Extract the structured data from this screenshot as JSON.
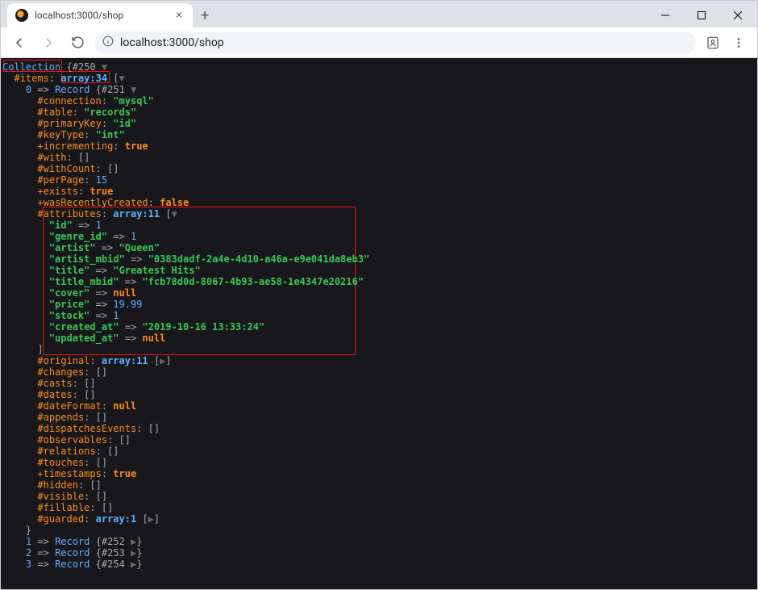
{
  "browser": {
    "tab_title": "localhost:3000/shop",
    "url": "localhost:3000/shop"
  },
  "dump": {
    "class": "Collection",
    "object_id": "#250",
    "items": {
      "key": "#items",
      "type": "array:34",
      "first_index": "0",
      "record_class": "Record",
      "record_id": "#251"
    },
    "record_props": [
      {
        "sym": "#",
        "key": "connection",
        "val": "\"mysql\"",
        "cls": "str"
      },
      {
        "sym": "#",
        "key": "table",
        "val": "\"records\"",
        "cls": "str"
      },
      {
        "sym": "#",
        "key": "primaryKey",
        "val": "\"id\"",
        "cls": "str"
      },
      {
        "sym": "#",
        "key": "keyType",
        "val": "\"int\"",
        "cls": "str"
      },
      {
        "sym": "+",
        "key": "incrementing",
        "val": "true",
        "cls": "bool"
      },
      {
        "sym": "#",
        "key": "with",
        "val": "[]",
        "cls": "punc"
      },
      {
        "sym": "#",
        "key": "withCount",
        "val": "[]",
        "cls": "punc"
      },
      {
        "sym": "#",
        "key": "perPage",
        "val": "15",
        "cls": "num"
      },
      {
        "sym": "+",
        "key": "exists",
        "val": "true",
        "cls": "bool"
      },
      {
        "sym": "+",
        "key": "wasRecentlyCreated",
        "val": "false",
        "cls": "bool"
      }
    ],
    "attributes_header": {
      "key": "#attributes",
      "type": "array:11"
    },
    "attributes": [
      {
        "k": "\"id\"",
        "v": "1",
        "cls": "num"
      },
      {
        "k": "\"genre_id\"",
        "v": "1",
        "cls": "num"
      },
      {
        "k": "\"artist\"",
        "v": "\"Queen\"",
        "cls": "str"
      },
      {
        "k": "\"artist_mbid\"",
        "v": "\"0383dadf-2a4e-4d10-a46a-e9e041da8eb3\"",
        "cls": "str"
      },
      {
        "k": "\"title\"",
        "v": "\"Greatest Hits\"",
        "cls": "str"
      },
      {
        "k": "\"title_mbid\"",
        "v": "\"fcb78d0d-8067-4b93-ae58-1e4347e20216\"",
        "cls": "str"
      },
      {
        "k": "\"cover\"",
        "v": "null",
        "cls": "null"
      },
      {
        "k": "\"price\"",
        "v": "19.99",
        "cls": "num"
      },
      {
        "k": "\"stock\"",
        "v": "1",
        "cls": "num"
      },
      {
        "k": "\"created_at\"",
        "v": "\"2019-10-16 13:33:24\"",
        "cls": "str"
      },
      {
        "k": "\"updated_at\"",
        "v": "null",
        "cls": "null"
      }
    ],
    "tail_props": [
      {
        "sym": "#",
        "key": "original",
        "type": "array:11",
        "toggle": "▶"
      },
      {
        "sym": "#",
        "key": "changes",
        "val": "[]"
      },
      {
        "sym": "#",
        "key": "casts",
        "val": "[]"
      },
      {
        "sym": "#",
        "key": "dates",
        "val": "[]"
      },
      {
        "sym": "#",
        "key": "dateFormat",
        "val": "null",
        "cls": "null"
      },
      {
        "sym": "#",
        "key": "appends",
        "val": "[]"
      },
      {
        "sym": "#",
        "key": "dispatchesEvents",
        "val": "[]"
      },
      {
        "sym": "#",
        "key": "observables",
        "val": "[]"
      },
      {
        "sym": "#",
        "key": "relations",
        "val": "[]"
      },
      {
        "sym": "#",
        "key": "touches",
        "val": "[]"
      },
      {
        "sym": "+",
        "key": "timestamps",
        "val": "true",
        "cls": "bool"
      },
      {
        "sym": "#",
        "key": "hidden",
        "val": "[]"
      },
      {
        "sym": "#",
        "key": "visible",
        "val": "[]"
      },
      {
        "sym": "#",
        "key": "fillable",
        "val": "[]"
      },
      {
        "sym": "#",
        "key": "guarded",
        "type": "array:1",
        "toggle": "▶"
      }
    ],
    "closing_brace": "}",
    "siblings": [
      {
        "idx": "1",
        "cls": "Record",
        "id": "#252"
      },
      {
        "idx": "2",
        "cls": "Record",
        "id": "#253"
      },
      {
        "idx": "3",
        "cls": "Record",
        "id": "#254"
      }
    ]
  }
}
